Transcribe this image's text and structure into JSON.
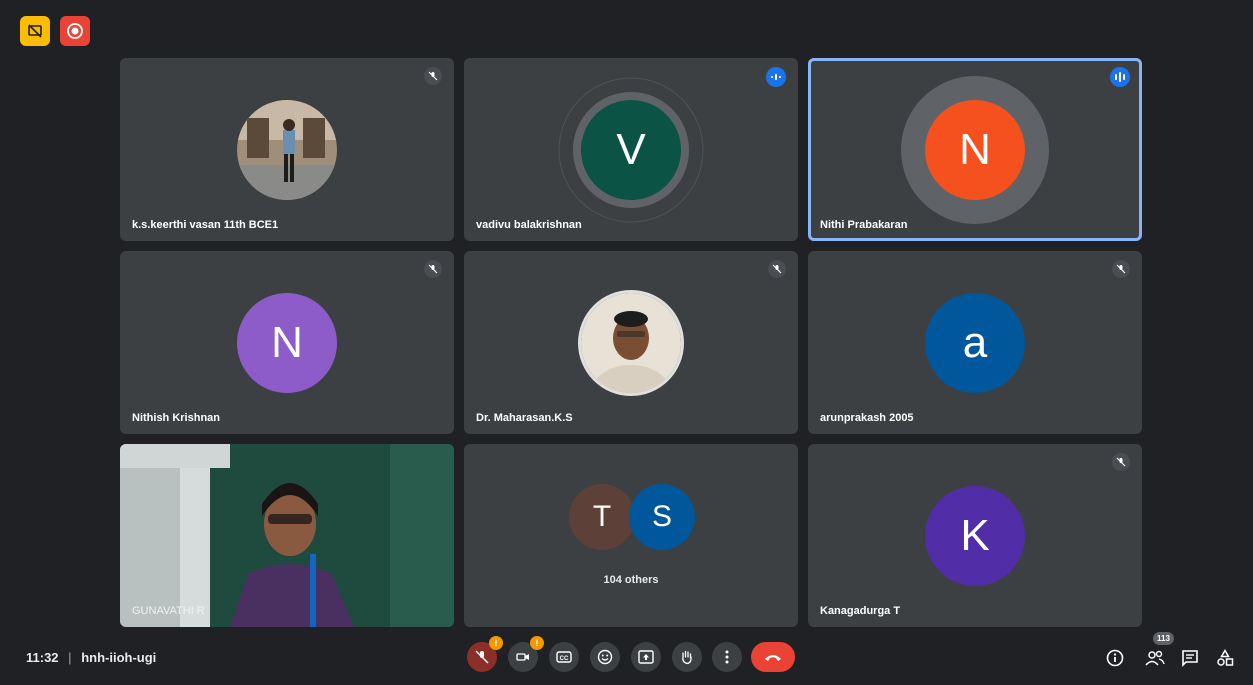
{
  "top_badges": {
    "present_icon": "present-to-all-off-icon",
    "record_icon": "recording-icon"
  },
  "tiles": [
    {
      "name": "k.s.keerthi vasan 11th BCE1",
      "kind": "photo",
      "status": "muted"
    },
    {
      "name": "vadivu balakrishnan",
      "kind": "avatar",
      "initial": "V",
      "color": "#0b5345",
      "status": "speaking"
    },
    {
      "name": "Nithi Prabakaran",
      "kind": "avatar",
      "initial": "N",
      "color": "#f4511e",
      "status": "speaking"
    },
    {
      "name": "Nithish Krishnan",
      "kind": "avatar",
      "initial": "N",
      "color": "#8e5cc8",
      "status": "muted"
    },
    {
      "name": "Dr. Maharasan.K.S",
      "kind": "photo",
      "status": "muted"
    },
    {
      "name": "arunprakash 2005",
      "kind": "avatar",
      "initial": "a",
      "color": "#01579b",
      "status": "muted"
    },
    {
      "name": "GUNAVATHI R",
      "kind": "video",
      "status": "none"
    },
    {
      "name": "104 others",
      "kind": "group",
      "initials": [
        "T",
        "S"
      ],
      "colors": [
        "#5d4037",
        "#01579b"
      ]
    },
    {
      "name": "Kanagadurga T",
      "kind": "avatar",
      "initial": "K",
      "color": "#512da8",
      "status": "muted"
    }
  ],
  "bottom_bar": {
    "time": "11:32",
    "separator": "|",
    "meeting_code": "hnh-iioh-ugi",
    "alert_mark": "!",
    "participants_count": "113",
    "end_call_color": "#ea4335",
    "mic_off_color": "#8c2f28"
  }
}
